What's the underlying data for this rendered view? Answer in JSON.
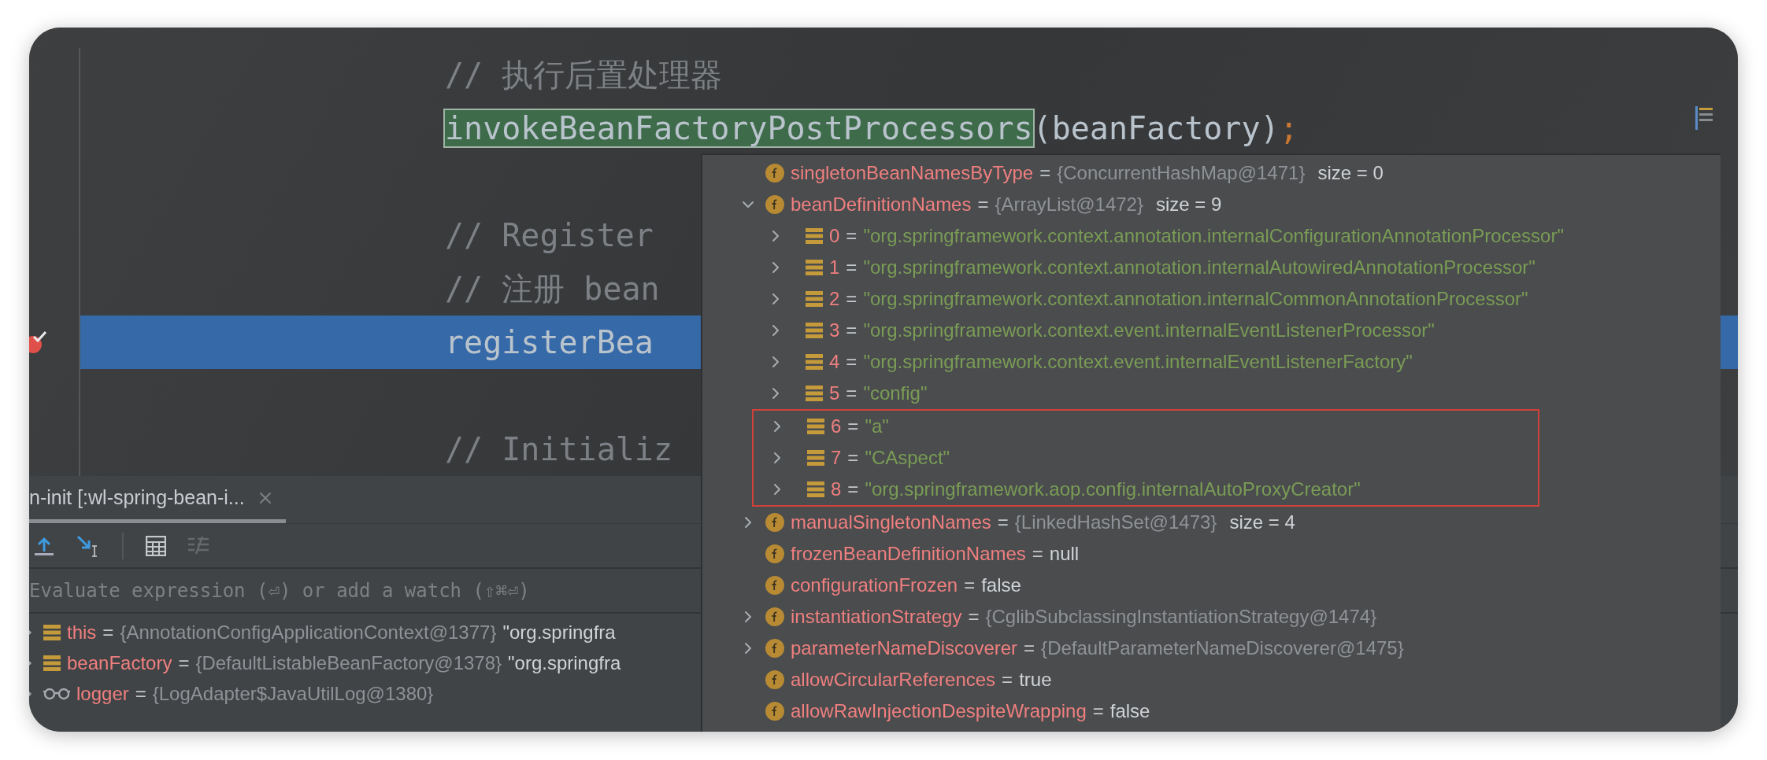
{
  "editor": {
    "lines": [
      {
        "kind": "comment",
        "text": "// 执行后置处理器",
        "current": false,
        "breakpoint": false
      },
      {
        "kind": "call",
        "method": "invokeBeanFactoryPostProcessors",
        "args": "(beanFactory)",
        "end": ";",
        "highlighted": true,
        "current": false,
        "breakpoint": false
      },
      {
        "kind": "blank",
        "current": false,
        "breakpoint": false
      },
      {
        "kind": "comment",
        "text": "// Register",
        "current": false,
        "breakpoint": false
      },
      {
        "kind": "comment",
        "text": "// 注册 bean",
        "current": false,
        "breakpoint": false
      },
      {
        "kind": "code",
        "text": "registerBea",
        "current": true,
        "breakpoint": true
      },
      {
        "kind": "blank",
        "current": false,
        "breakpoint": false
      },
      {
        "kind": "comment",
        "text": "// Initializ",
        "current": false,
        "breakpoint": false
      }
    ]
  },
  "debug": {
    "tab": {
      "label": "n-init [:wl-spring-bean-i...",
      "selected": true
    },
    "evaluate": {
      "placeholder": "Evaluate expression (⏎) or add a watch (⇧⌘⏎)"
    },
    "variables": [
      {
        "kind": "stack",
        "name": "this",
        "eq": "=",
        "value": "{AnnotationConfigApplicationContext@1377}",
        "extra": "\"org.springfra"
      },
      {
        "kind": "stack",
        "name": "beanFactory",
        "eq": "=",
        "value": "{DefaultListableBeanFactory@1378}",
        "extra": "\"org.springfra"
      },
      {
        "kind": "watch",
        "name": "logger",
        "eq": "=",
        "value": "{LogAdapter$JavaUtilLog@1380}"
      }
    ]
  },
  "popup": {
    "rows": [
      {
        "name": "singletonBeanNamesByType",
        "eq": "=",
        "value": "{ConcurrentHashMap@1471}",
        "kind": "object",
        "size": "size = 0"
      },
      {
        "name": "beanDefinitionNames",
        "eq": "=",
        "value": "{ArrayList@1472}",
        "kind": "object",
        "size": "size = 9",
        "expanded": true,
        "children": [
          {
            "name": "0",
            "eq": "=",
            "value": "\"org.springframework.context.annotation.internalConfigurationAnnotationProcessor\"",
            "kind": "string",
            "expanded": false,
            "highlighted": false
          },
          {
            "name": "1",
            "eq": "=",
            "value": "\"org.springframework.context.annotation.internalAutowiredAnnotationProcessor\"",
            "kind": "string",
            "expanded": false,
            "highlighted": false
          },
          {
            "name": "2",
            "eq": "=",
            "value": "\"org.springframework.context.annotation.internalCommonAnnotationProcessor\"",
            "kind": "string",
            "expanded": false,
            "highlighted": false
          },
          {
            "name": "3",
            "eq": "=",
            "value": "\"org.springframework.context.event.internalEventListenerProcessor\"",
            "kind": "string",
            "expanded": false,
            "highlighted": false
          },
          {
            "name": "4",
            "eq": "=",
            "value": "\"org.springframework.context.event.internalEventListenerFactory\"",
            "kind": "string",
            "expanded": false,
            "highlighted": false
          },
          {
            "name": "5",
            "eq": "=",
            "value": "\"config\"",
            "kind": "string",
            "expanded": false,
            "highlighted": false
          },
          {
            "name": "6",
            "eq": "=",
            "value": "\"a\"",
            "kind": "string",
            "expanded": false,
            "highlighted": true
          },
          {
            "name": "7",
            "eq": "=",
            "value": "\"CAspect\"",
            "kind": "string",
            "expanded": false,
            "highlighted": true
          },
          {
            "name": "8",
            "eq": "=",
            "value": "\"org.springframework.aop.config.internalAutoProxyCreator\"",
            "kind": "string",
            "expanded": false,
            "highlighted": true
          }
        ]
      },
      {
        "name": "manualSingletonNames",
        "eq": "=",
        "value": "{LinkedHashSet@1473}",
        "kind": "object",
        "size": "size = 4",
        "expanded": false
      },
      {
        "name": "frozenBeanDefinitionNames",
        "eq": "=",
        "value": "null",
        "kind": "literal"
      },
      {
        "name": "configurationFrozen",
        "eq": "=",
        "value": "false",
        "kind": "literal"
      },
      {
        "name": "instantiationStrategy",
        "eq": "=",
        "value": "{CglibSubclassingInstantiationStrategy@1474}",
        "kind": "object",
        "expanded": false
      },
      {
        "name": "parameterNameDiscoverer",
        "eq": "=",
        "value": "{DefaultParameterNameDiscoverer@1475}",
        "kind": "object",
        "expanded": false
      },
      {
        "name": "allowCircularReferences",
        "eq": "=",
        "value": "true",
        "kind": "literal"
      },
      {
        "name": "allowRawInjectionDespiteWrapping",
        "eq": "=",
        "value": "false",
        "kind": "literal"
      }
    ]
  }
}
